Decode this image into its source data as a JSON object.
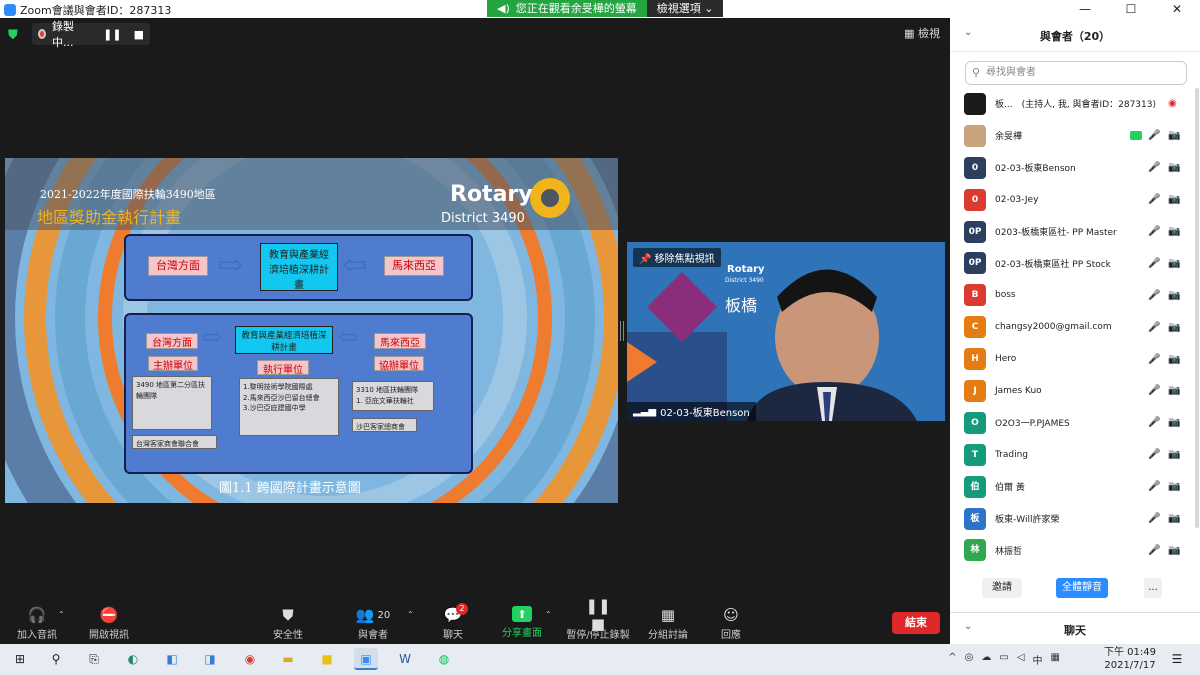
{
  "window": {
    "title": "Zoom會議與會者ID：287313",
    "buttons": [
      "—",
      "☐",
      "✕"
    ]
  },
  "viewing_bar": {
    "message": "您正在觀看余旻樺的螢幕",
    "options_label": "檢視選項 ⌄"
  },
  "stage": {
    "recording_label": "錄製中...",
    "view_label": "檢視"
  },
  "slide": {
    "year_title": "2021-2022年度國際扶輪3490地區",
    "main_title": "地區獎助金執行計畫",
    "rotary_logo": "Rotary",
    "district": "District 3490",
    "box1": {
      "left": "台灣方面",
      "center": "教育與產業經濟培植深耕計畫",
      "right": "馬來西亞"
    },
    "box2": {
      "left": "台灣方面",
      "center": "教育與產業經濟培植深耕計畫",
      "right": "馬來西亞",
      "host_unit": "主辦單位",
      "exec_unit": "執行單位",
      "co_unit": "協辦單位",
      "host_detail": "3490 地區第二分區扶輪團隊",
      "exec_detail": "1.黎明技術學院國際處\n2.馬來西亞沙巴留台總會\n3.沙巴亞庇建國中學",
      "co_detail": "3310 地區扶輪團隊\n1. 亞庇文華扶輪社",
      "host_sub": "台灣客家商會聯合會",
      "co_sub": "沙巴客家總商會"
    },
    "caption": "圖1.1 跨國際計畫示意圖"
  },
  "speaker": {
    "pin_label": "移除焦點視訊",
    "name": "02-03-板東Benson",
    "bg_logo": "Rotary",
    "bg_district": "District 3490",
    "bg_text": "板橋"
  },
  "toolbar": {
    "audio": "加入音訊",
    "video": "開啟視訊",
    "security": "安全性",
    "participants": "與會者",
    "participants_count": "20",
    "chat": "聊天",
    "chat_badge": "2",
    "share": "分享畫面",
    "record": "暫停/停止錄製",
    "breakout": "分組討論",
    "reactions": "回應",
    "end": "結束"
  },
  "panel": {
    "title": "與會者（20）",
    "search_placeholder": "尋找與會者",
    "invite": "邀請",
    "mute_all": "全體靜音",
    "more": "...",
    "chat_title": "聊天",
    "participants": [
      {
        "avatar": "",
        "color": "#1b1b1b",
        "name": "板...　(主持人, 我, 與會者ID：287313)",
        "mic": "",
        "cam": "◉",
        "mic_muted": false,
        "cam_muted": false,
        "host": true
      },
      {
        "avatar": "",
        "color": "#c9a27e",
        "name": "余旻樺",
        "mic": "🎤",
        "cam": "📷",
        "mic_muted": false,
        "cam_muted": true,
        "sharing": true
      },
      {
        "avatar": "0",
        "color": "#2d3f5f",
        "name": "02-03-板東Benson",
        "mic": "🎤",
        "cam": "📷",
        "mic_muted": false,
        "cam_muted": false
      },
      {
        "avatar": "0",
        "color": "#d93b30",
        "name": "02-03-Jey",
        "mic": "🎤",
        "cam": "📷",
        "mic_muted": true,
        "cam_muted": false
      },
      {
        "avatar": "0P",
        "color": "#2d3f5f",
        "name": "0203-板橋東區社- PP Master",
        "mic": "🎤",
        "cam": "📷",
        "mic_muted": true,
        "cam_muted": true
      },
      {
        "avatar": "0P",
        "color": "#2d3f5f",
        "name": "02-03-板橋東區社 PP Stock",
        "mic": "🎤",
        "cam": "📷",
        "mic_muted": true,
        "cam_muted": false
      },
      {
        "avatar": "B",
        "color": "#d93b30",
        "name": "boss",
        "mic": "🎤",
        "cam": "📷",
        "mic_muted": true,
        "cam_muted": false
      },
      {
        "avatar": "C",
        "color": "#e57c12",
        "name": "changsy2000@gmail.com",
        "mic": "🎤",
        "cam": "📷",
        "mic_muted": true,
        "cam_muted": false
      },
      {
        "avatar": "H",
        "color": "#e57c12",
        "name": "Hero",
        "mic": "🎤",
        "cam": "📷",
        "mic_muted": true,
        "cam_muted": true
      },
      {
        "avatar": "J",
        "color": "#e57c12",
        "name": "James Kuo",
        "mic": "🎤",
        "cam": "📷",
        "mic_muted": true,
        "cam_muted": true
      },
      {
        "avatar": "O",
        "color": "#169b7a",
        "name": "O2O3一P.PJAMES",
        "mic": "🎤",
        "cam": "📷",
        "mic_muted": true,
        "cam_muted": false
      },
      {
        "avatar": "T",
        "color": "#169b7a",
        "name": "Trading",
        "mic": "🎤",
        "cam": "📷",
        "mic_muted": true,
        "cam_muted": false
      },
      {
        "avatar": "伯",
        "color": "#169b7a",
        "name": "伯爾 黃",
        "mic": "🎤",
        "cam": "📷",
        "mic_muted": true,
        "cam_muted": false
      },
      {
        "avatar": "板",
        "color": "#2c74c9",
        "name": "板東-Will許家榮",
        "mic": "🎤",
        "cam": "📷",
        "mic_muted": true,
        "cam_muted": false
      },
      {
        "avatar": "林",
        "color": "#2fa84f",
        "name": "林振哲",
        "mic": "🎤",
        "cam": "📷",
        "mic_muted": true,
        "cam_muted": true
      }
    ]
  },
  "taskbar": {
    "time": "下午 01:49",
    "date": "2021/7/17"
  }
}
